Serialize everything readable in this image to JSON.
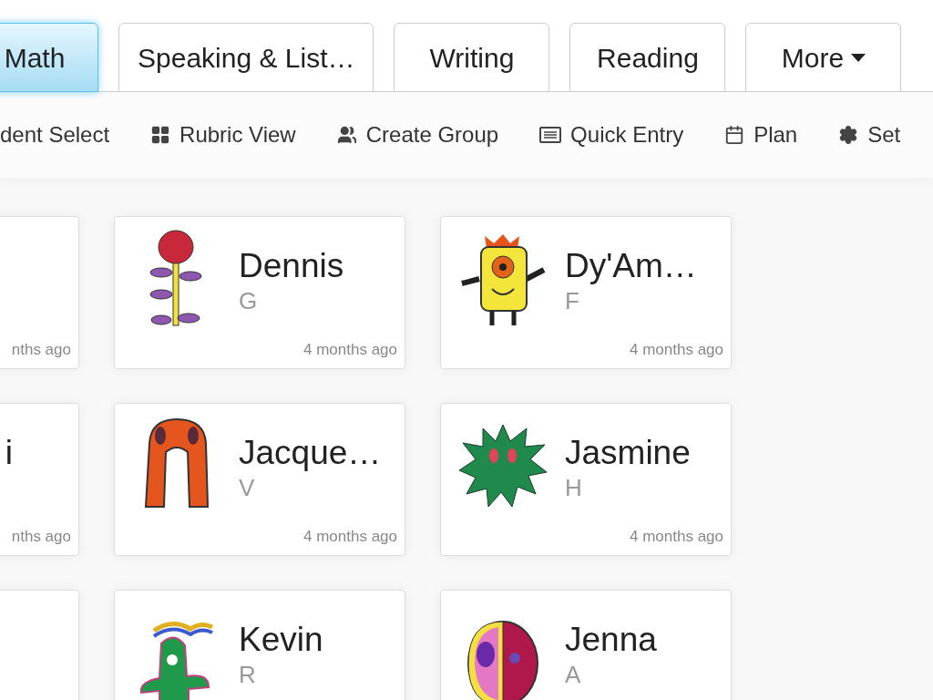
{
  "tabs": [
    {
      "label": "Math",
      "selected": true,
      "dropdown": false
    },
    {
      "label": "Speaking & List…",
      "selected": false,
      "dropdown": false
    },
    {
      "label": "Writing",
      "selected": false,
      "dropdown": false
    },
    {
      "label": "Reading",
      "selected": false,
      "dropdown": false
    },
    {
      "label": "More",
      "selected": false,
      "dropdown": true
    }
  ],
  "toolbar": [
    {
      "label": "dent Select",
      "kind": "none"
    },
    {
      "label": "Rubric View",
      "kind": "grid"
    },
    {
      "label": "Create Group",
      "kind": "group"
    },
    {
      "label": "Quick Entry",
      "kind": "entry"
    },
    {
      "label": "Plan",
      "kind": "calendar"
    },
    {
      "label": "Set",
      "kind": "settings"
    }
  ],
  "student_rows": [
    [
      {
        "kind": "partial",
        "time": "nths ago"
      },
      {
        "kind": "rose",
        "name": "Dennis",
        "letter": "G",
        "time": "4 months ago"
      },
      {
        "kind": "monster",
        "name": "Dy'Am…",
        "letter": "F",
        "time": "4 months ago"
      }
    ],
    [
      {
        "kind": "partial",
        "name": "i",
        "time": "nths ago"
      },
      {
        "kind": "arch",
        "name": "Jacque…",
        "letter": "V",
        "time": "4 months ago"
      },
      {
        "kind": "spiky",
        "name": "Jasmine",
        "letter": "H",
        "time": "4 months ago"
      }
    ],
    [
      {
        "kind": "partial"
      },
      {
        "kind": "cactus",
        "name": "Kevin",
        "letter": "R"
      },
      {
        "kind": "face",
        "name": "Jenna",
        "letter": "A"
      }
    ]
  ]
}
